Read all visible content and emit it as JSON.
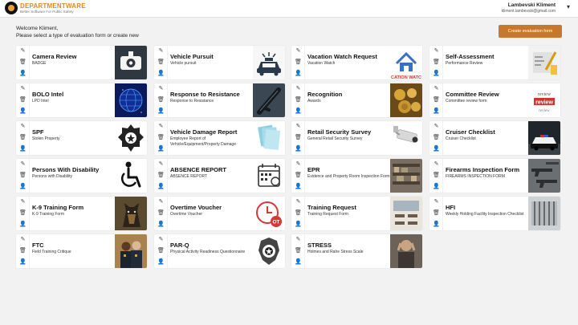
{
  "app": {
    "logo_title": "DEPARTMENTWARE",
    "logo_subtitle": "Better Software For Public Safety",
    "user_name": "Lambevski Kliment",
    "user_email": "kliment.lambevski@gmail.com"
  },
  "welcome": {
    "line1": "Welcome Kliment,",
    "line2": "Please select a type of evaluation form or create new"
  },
  "create_button_label": "Create evaluation form",
  "forms": [
    {
      "title": "Camera Review",
      "subtitle": "BADGE",
      "icon": "dashcam"
    },
    {
      "title": "Vehicle Pursuit",
      "subtitle": "Vehicle pursuit",
      "icon": "police-car"
    },
    {
      "title": "Vacation Watch Request",
      "subtitle": "Vacation Watch",
      "icon": "house-watch",
      "thumb_text": "CATION WATC"
    },
    {
      "title": "Self-Assessment",
      "subtitle": "Performance Review",
      "icon": "assessment"
    },
    {
      "title": "BOLO Intel",
      "subtitle": "LPD Intel",
      "icon": "digital-globe"
    },
    {
      "title": "Response to Resistance",
      "subtitle": "Response to Resistance",
      "icon": "baton"
    },
    {
      "title": "Recognition",
      "subtitle": "Awards",
      "icon": "medals"
    },
    {
      "title": "Committee Review",
      "subtitle": "Committee review form",
      "icon": "review-words",
      "thumb_text": "review"
    },
    {
      "title": "SPF",
      "subtitle": "Stolen Property",
      "icon": "police-badge"
    },
    {
      "title": "Vehicle Damage Report",
      "subtitle": "Employee Report of Vehicle/Equipment/Property Damage",
      "icon": "documents"
    },
    {
      "title": "Retail Security Survey",
      "subtitle": "General Retail Security Survey",
      "icon": "security-camera"
    },
    {
      "title": "Cruiser Checklist",
      "subtitle": "Cruiser Checklist",
      "icon": "cruiser"
    },
    {
      "title": "Persons With Disability",
      "subtitle": "Persons with Disability",
      "icon": "wheelchair"
    },
    {
      "title": "ABSENCE REPORT",
      "subtitle": "ABSENCE REPORT",
      "icon": "calendar"
    },
    {
      "title": "EPR",
      "subtitle": "Evidence and Property Room Inspection Form",
      "icon": "evidence-room"
    },
    {
      "title": "Firearms Inspection Form",
      "subtitle": "FIREARMS INSPECTION FORM",
      "icon": "firearms"
    },
    {
      "title": "K-9 Training Form",
      "subtitle": "K-9 Training Form",
      "icon": "k9-dog"
    },
    {
      "title": "Overtime Voucher",
      "subtitle": "Overtime Voucher",
      "icon": "overtime-clock",
      "thumb_text": "OT"
    },
    {
      "title": "Training Request",
      "subtitle": "Training Request Form",
      "icon": "classroom"
    },
    {
      "title": "HFI",
      "subtitle": "Weekly Holding Facility Inspection Checklist",
      "icon": "holding-cell"
    },
    {
      "title": "FTC",
      "subtitle": "Field Training Critique",
      "icon": "officers"
    },
    {
      "title": "PAR-Q",
      "subtitle": "Physical Activity Readiness Questionnaire",
      "icon": "badge-emblem"
    },
    {
      "title": "STRESS",
      "subtitle": "Holmes and Rahe Stress Scale",
      "icon": "stress-photo"
    }
  ],
  "colors": {
    "accent": "#c9772b",
    "logo": "#e08a20",
    "page_bg": "#f2f2f2"
  }
}
